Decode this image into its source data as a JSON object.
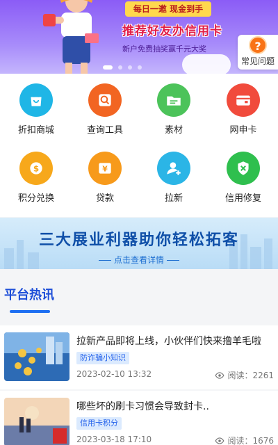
{
  "banner": {
    "ribbon": "每日一邀 现金到手",
    "headline": "推荐好友办信用卡",
    "subline": "新户免费抽奖赢千元大奖",
    "faq_label": "常见问题",
    "faq_symbol": "?"
  },
  "grid": [
    {
      "label": "折扣商城",
      "icon": "shopping-bag-icon",
      "color": "#1fb6e6"
    },
    {
      "label": "查询工具",
      "icon": "search-icon",
      "color": "#f26522"
    },
    {
      "label": "素材",
      "icon": "folder-icon",
      "color": "#4cc35a"
    },
    {
      "label": "网申卡",
      "icon": "credit-card-icon",
      "color": "#f14b3c"
    },
    {
      "label": "积分兑换",
      "icon": "coin-icon",
      "color": "#f7a81b"
    },
    {
      "label": "贷款",
      "icon": "money-icon",
      "color": "#f79a1b"
    },
    {
      "label": "拉新",
      "icon": "add-user-icon",
      "color": "#2bb5e6"
    },
    {
      "label": "信用修复",
      "icon": "shield-icon",
      "color": "#2fbf4e"
    }
  ],
  "promo": {
    "title": "三大展业利器助你轻松拓客",
    "link": "点击查看详情"
  },
  "hot": {
    "title": "平台热讯"
  },
  "news": [
    {
      "title": "拉新产品即将上线，小伙伴们快来撸羊毛啦",
      "tag": "防诈骗小知识",
      "date": "2023-02-10 13:32",
      "views_label": "阅读：2261"
    },
    {
      "title": "哪些坏的刷卡习惯会导致封卡..",
      "tag": "信用卡积分",
      "date": "2023-03-18 17:10",
      "views_label": "阅读：1676"
    }
  ]
}
